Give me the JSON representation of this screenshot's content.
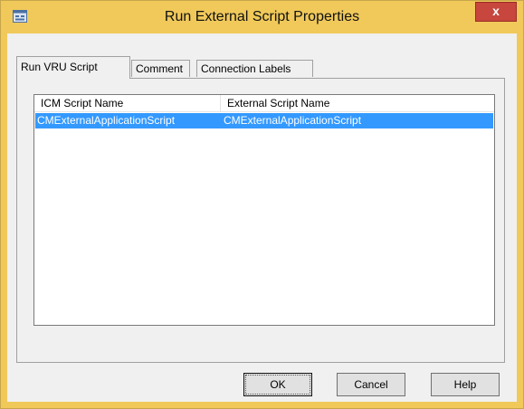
{
  "window": {
    "title": "Run External Script Properties",
    "close_glyph": "x",
    "icon": "app-window-icon"
  },
  "tabs": [
    {
      "label": "Run VRU Script",
      "active": true
    },
    {
      "label": "Comment",
      "active": false
    },
    {
      "label": "Connection Labels",
      "active": false
    }
  ],
  "list": {
    "columns": [
      "ICM Script Name",
      "External Script Name"
    ],
    "rows": [
      {
        "icm_script_name": "CMExternalApplicationScript",
        "external_script_name": "CMExternalApplicationScript",
        "selected": true
      }
    ]
  },
  "buttons": {
    "ok": "OK",
    "cancel": "Cancel",
    "help": "Help"
  },
  "colors": {
    "titlebar": "#f0c95a",
    "close": "#c7463d",
    "selection": "#3399ff",
    "dialog_bg": "#f0f0f0"
  }
}
